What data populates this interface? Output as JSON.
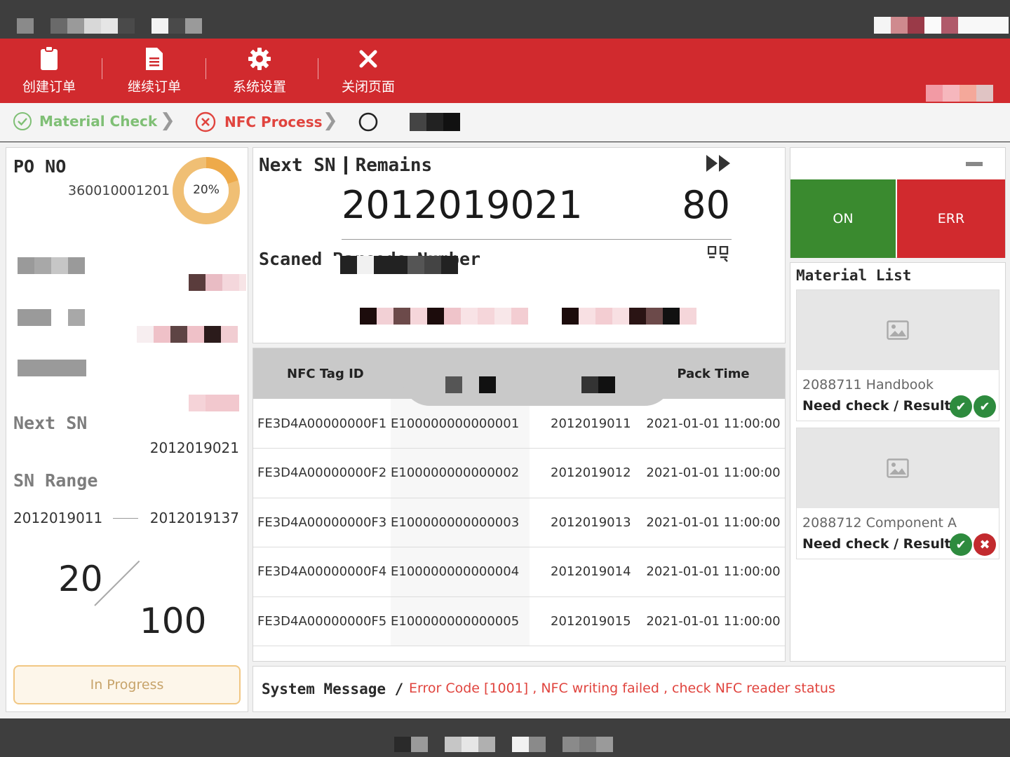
{
  "toolbar": {
    "items": [
      {
        "label": "创建订单",
        "icon": "clipboard-icon"
      },
      {
        "label": "继续订单",
        "icon": "document-icon"
      },
      {
        "label": "系统设置",
        "icon": "gear-icon"
      },
      {
        "label": "关闭页面",
        "icon": "close-icon"
      }
    ]
  },
  "steps": {
    "step1": {
      "label": "Material Check",
      "status": "done"
    },
    "step2": {
      "label": "NFC Process",
      "status": "error"
    },
    "step3": {
      "status": "pending"
    }
  },
  "left": {
    "po_label": "PO NO",
    "po_number": "360010001201",
    "progress_label": "20%",
    "progress_fraction": 0.2,
    "next_sn_label": "Next SN",
    "next_sn_value": "2012019021",
    "sn_range_label": "SN Range",
    "sn_range_start": "2012019011",
    "sn_range_end": "2012019137",
    "count_done": "20",
    "count_total": "100",
    "status_button": "In Progress"
  },
  "next": {
    "header_next": "Next SN",
    "header_remains": "Remains",
    "next_sn": "2012019021",
    "remains": "80",
    "scanned_label": "Scaned Barcode Number"
  },
  "table": {
    "headers": [
      "NFC Tag ID",
      "",
      "",
      "Pack Time"
    ],
    "rows": [
      [
        "FE3D4A00000000F1",
        "E100000000000001",
        "2012019011",
        "2021-01-01 11:00:00"
      ],
      [
        "FE3D4A00000000F2",
        "E100000000000002",
        "2012019012",
        "2021-01-01 11:00:00"
      ],
      [
        "FE3D4A00000000F3",
        "E100000000000003",
        "2012019013",
        "2021-01-01 11:00:00"
      ],
      [
        "FE3D4A00000000F4",
        "E100000000000004",
        "2012019014",
        "2021-01-01 11:00:00"
      ],
      [
        "FE3D4A00000000F5",
        "E100000000000005",
        "2012019015",
        "2021-01-01 11:00:00"
      ]
    ]
  },
  "status": {
    "on_label": "ON",
    "err_label": "ERR",
    "on_color": "#3a8a2f",
    "err_color": "#d12a2e"
  },
  "material": {
    "title": "Material List",
    "items": [
      {
        "name": "2088711 Handbook",
        "check_label": "Need check / Result",
        "check": "ok",
        "result": "ok"
      },
      {
        "name": "2088712 Component A",
        "check_label": "Need check / Result",
        "check": "ok",
        "result": "fail"
      }
    ]
  },
  "message": {
    "label": "System Message /",
    "text": "Error Code [1001] , NFC writing failed , check NFC reader status"
  }
}
